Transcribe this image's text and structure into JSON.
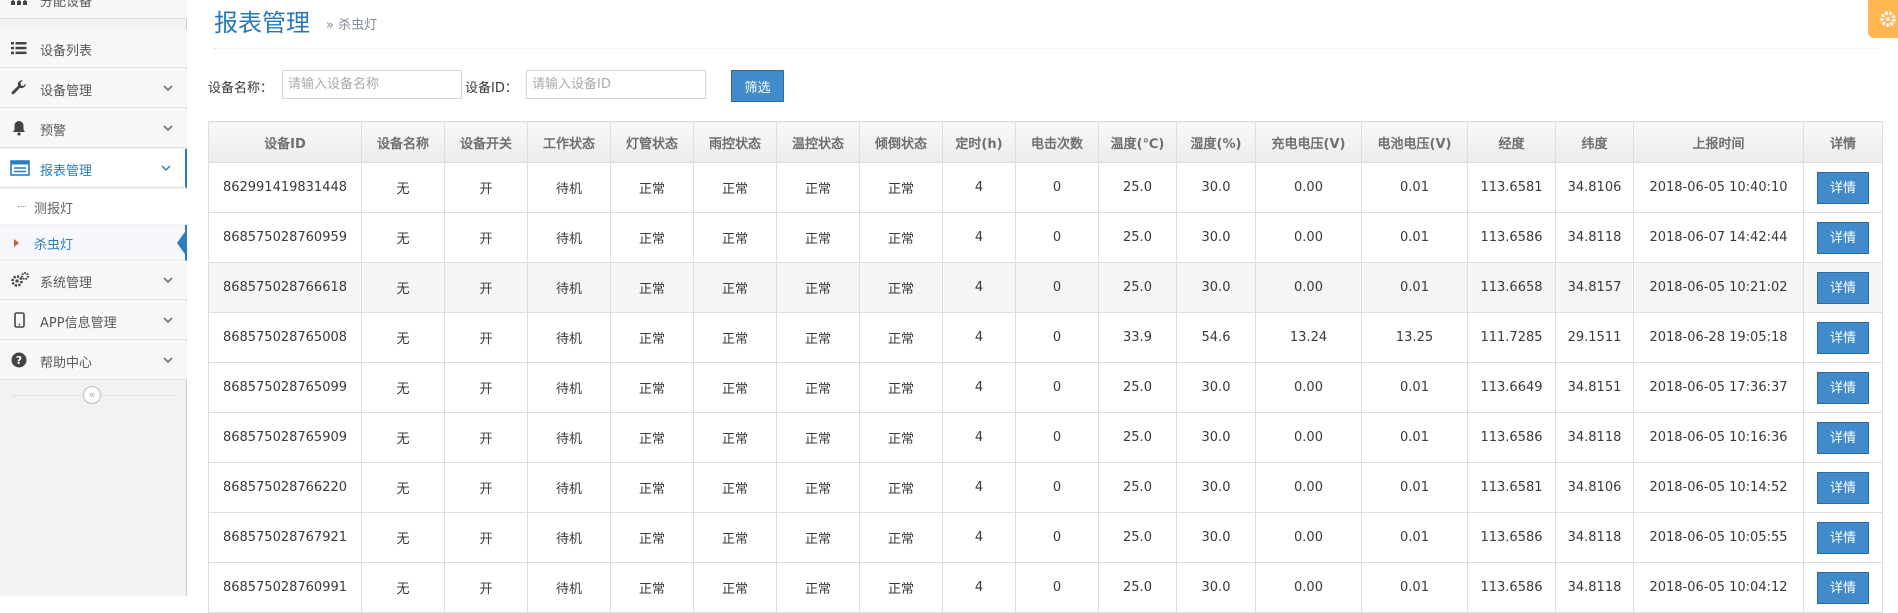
{
  "sidebar": {
    "items": [
      {
        "label": "分配设备",
        "icon": "sitemap-icon"
      },
      {
        "label": "设备列表",
        "icon": "list-icon"
      },
      {
        "label": "设备管理",
        "icon": "wrench-icon"
      },
      {
        "label": "预警",
        "icon": "bell-icon"
      },
      {
        "label": "报表管理",
        "icon": "report-icon"
      },
      {
        "label": "系统管理",
        "icon": "gears-icon"
      },
      {
        "label": "APP信息管理",
        "icon": "mobile-icon"
      },
      {
        "label": "帮助中心",
        "icon": "question-icon"
      }
    ],
    "sub_items": [
      {
        "label": "测报灯"
      },
      {
        "label": "杀虫灯"
      }
    ],
    "collapse_glyph": "«"
  },
  "header": {
    "title": "报表管理",
    "subtitle": "» 杀虫灯"
  },
  "filter": {
    "name_label": "设备名称：",
    "name_placeholder": "请输入设备名称",
    "id_label": "设备ID：",
    "id_placeholder": "请输入设备ID",
    "button_label": "筛选"
  },
  "table": {
    "columns": [
      "设备ID",
      "设备名称",
      "设备开关",
      "工作状态",
      "灯管状态",
      "雨控状态",
      "温控状态",
      "倾倒状态",
      "定时(h)",
      "电击次数",
      "温度(℃)",
      "湿度(%)",
      "充电电压(V)",
      "电池电压(V)",
      "经度",
      "纬度",
      "上报时间",
      "详情"
    ],
    "detail_label": "详情",
    "rows": [
      [
        "862991419831448",
        "无",
        "开",
        "待机",
        "正常",
        "正常",
        "正常",
        "正常",
        "4",
        "0",
        "25.0",
        "30.0",
        "0.00",
        "0.01",
        "113.6581",
        "34.8106",
        "2018-06-05 10:40:10"
      ],
      [
        "868575028760959",
        "无",
        "开",
        "待机",
        "正常",
        "正常",
        "正常",
        "正常",
        "4",
        "0",
        "25.0",
        "30.0",
        "0.00",
        "0.01",
        "113.6586",
        "34.8118",
        "2018-06-07 14:42:44"
      ],
      [
        "868575028766618",
        "无",
        "开",
        "待机",
        "正常",
        "正常",
        "正常",
        "正常",
        "4",
        "0",
        "25.0",
        "30.0",
        "0.00",
        "0.01",
        "113.6658",
        "34.8157",
        "2018-06-05 10:21:02"
      ],
      [
        "868575028765008",
        "无",
        "开",
        "待机",
        "正常",
        "正常",
        "正常",
        "正常",
        "4",
        "0",
        "33.9",
        "54.6",
        "13.24",
        "13.25",
        "111.7285",
        "29.1511",
        "2018-06-28 19:05:18"
      ],
      [
        "868575028765099",
        "无",
        "开",
        "待机",
        "正常",
        "正常",
        "正常",
        "正常",
        "4",
        "0",
        "25.0",
        "30.0",
        "0.00",
        "0.01",
        "113.6649",
        "34.8151",
        "2018-06-05 17:36:37"
      ],
      [
        "868575028765909",
        "无",
        "开",
        "待机",
        "正常",
        "正常",
        "正常",
        "正常",
        "4",
        "0",
        "25.0",
        "30.0",
        "0.00",
        "0.01",
        "113.6586",
        "34.8118",
        "2018-06-05 10:16:36"
      ],
      [
        "868575028766220",
        "无",
        "开",
        "待机",
        "正常",
        "正常",
        "正常",
        "正常",
        "4",
        "0",
        "25.0",
        "30.0",
        "0.00",
        "0.01",
        "113.6581",
        "34.8106",
        "2018-06-05 10:14:52"
      ],
      [
        "868575028767921",
        "无",
        "开",
        "待机",
        "正常",
        "正常",
        "正常",
        "正常",
        "4",
        "0",
        "25.0",
        "30.0",
        "0.00",
        "0.01",
        "113.6586",
        "34.8118",
        "2018-06-05 10:05:55"
      ],
      [
        "868575028760991",
        "无",
        "开",
        "待机",
        "正常",
        "正常",
        "正常",
        "正常",
        "4",
        "0",
        "25.0",
        "30.0",
        "0.00",
        "0.01",
        "113.6586",
        "34.8118",
        "2018-06-05 10:04:12"
      ]
    ]
  },
  "colors": {
    "accent": "#2b7dbc",
    "button": "#428bca",
    "settings": "#ffb752"
  }
}
